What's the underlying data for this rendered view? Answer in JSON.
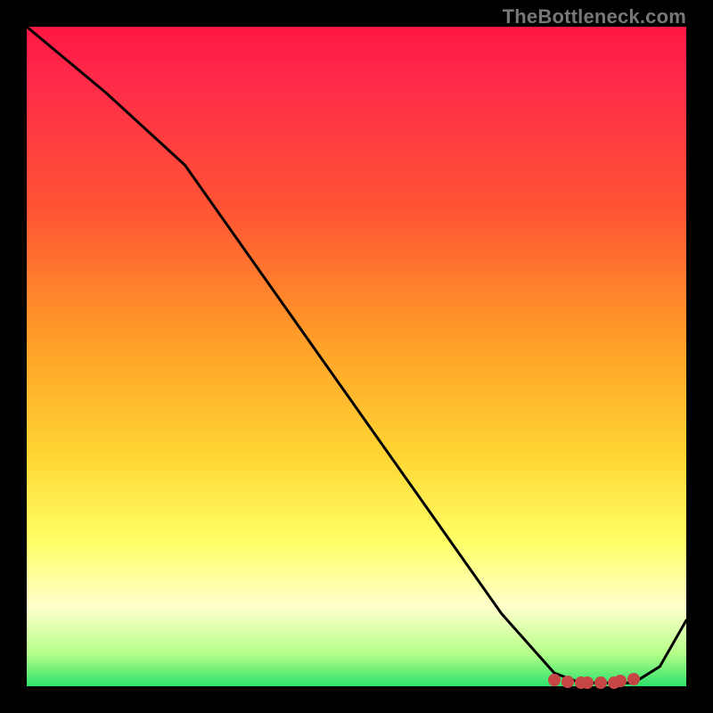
{
  "watermark": "TheBottleneck.com",
  "colors": {
    "curve": "#000000",
    "marker": "#c64545"
  },
  "chart_data": {
    "type": "line",
    "title": "",
    "xlabel": "",
    "ylabel": "",
    "xlim": [
      0,
      100
    ],
    "ylim": [
      0,
      100
    ],
    "grid": false,
    "legend": false,
    "series": [
      {
        "name": "curve",
        "x": [
          0,
          12,
          24,
          36,
          48,
          60,
          72,
          80,
          84,
          88,
          92,
          96,
          100
        ],
        "y": [
          100,
          90,
          79,
          62,
          45,
          28,
          11,
          2,
          0.5,
          0.5,
          0.5,
          3,
          10
        ]
      }
    ],
    "markers": {
      "x": [
        80,
        82,
        84,
        85,
        87,
        89,
        90,
        92
      ],
      "y": [
        0.9,
        0.7,
        0.6,
        0.6,
        0.6,
        0.6,
        0.8,
        1.1
      ]
    }
  }
}
